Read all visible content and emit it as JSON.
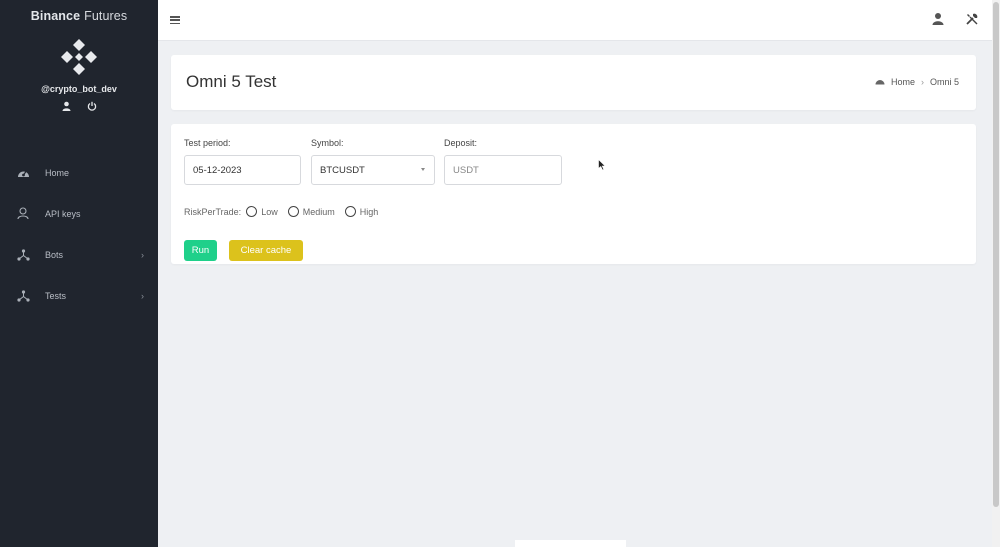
{
  "app": {
    "brand_bold": "Binance",
    "brand_rest": "Futures",
    "username": "@crypto_bot_dev"
  },
  "sidebar": {
    "items": [
      {
        "label": "Home",
        "icon": "dashboard-icon"
      },
      {
        "label": "API keys",
        "icon": "key-user-icon"
      },
      {
        "label": "Bots",
        "icon": "network-icon",
        "has_submenu": true
      },
      {
        "label": "Tests",
        "icon": "network-icon",
        "has_submenu": true
      }
    ]
  },
  "header": {
    "title": "Omni 5 Test",
    "breadcrumb_home": "Home",
    "breadcrumb_sep": "›",
    "breadcrumb_current": "Omni 5"
  },
  "form": {
    "test_period_label": "Test period:",
    "test_period_value": "05-12-2023",
    "symbol_label": "Symbol:",
    "symbol_value": "BTCUSDT",
    "deposit_label": "Deposit:",
    "deposit_placeholder": "USDT",
    "risk_label": "RiskPerTrade:",
    "risk_options": [
      "Low",
      "Medium",
      "High"
    ],
    "run_label": "Run",
    "clear_label": "Clear cache"
  },
  "colors": {
    "sidebar_bg": "#20252e",
    "run_button": "#1fd08a",
    "clear_button": "#dcc21c",
    "content_bg": "#eef0f3"
  }
}
